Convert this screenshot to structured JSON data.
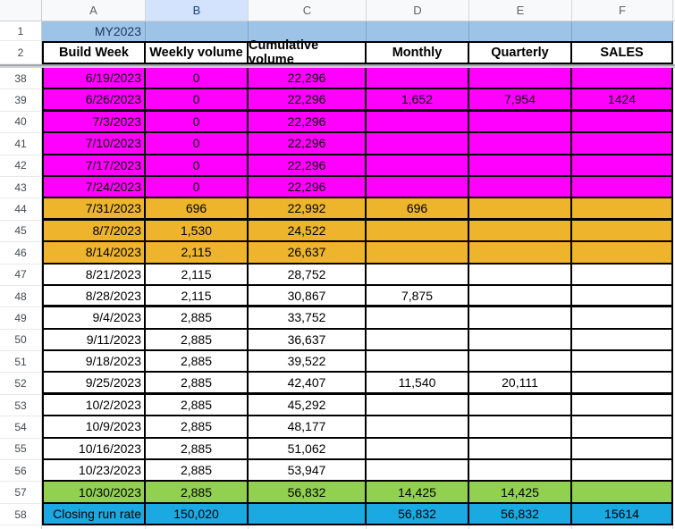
{
  "sheet": {
    "column_headers": [
      "A",
      "B",
      "C",
      "D",
      "E",
      "F"
    ],
    "selected_column": "B",
    "banner": {
      "row_number": "1",
      "text": "MY2023"
    },
    "header_row": {
      "row_number": "2",
      "cells": [
        "Build Week",
        "Weekly volume",
        "Cumulative volume",
        "Monthly",
        "Quarterly",
        "SALES"
      ]
    },
    "rows": [
      {
        "n": "38",
        "color": "magenta",
        "thick": false,
        "cells": [
          "6/19/2023",
          "0",
          "22,296",
          "",
          "",
          ""
        ]
      },
      {
        "n": "39",
        "color": "magenta",
        "thick": true,
        "cells": [
          "6/26/2023",
          "0",
          "22,296",
          "1,652",
          "7,954",
          "1424"
        ]
      },
      {
        "n": "40",
        "color": "magenta",
        "thick": false,
        "cells": [
          "7/3/2023",
          "0",
          "22,296",
          "",
          "",
          ""
        ]
      },
      {
        "n": "41",
        "color": "magenta",
        "thick": false,
        "cells": [
          "7/10/2023",
          "0",
          "22,296",
          "",
          "",
          ""
        ]
      },
      {
        "n": "42",
        "color": "magenta",
        "thick": false,
        "cells": [
          "7/17/2023",
          "0",
          "22,296",
          "",
          "",
          ""
        ]
      },
      {
        "n": "43",
        "color": "magenta",
        "thick": false,
        "cells": [
          "7/24/2023",
          "0",
          "22,296",
          "",
          "",
          ""
        ]
      },
      {
        "n": "44",
        "color": "orange",
        "thick": true,
        "cells": [
          "7/31/2023",
          "696",
          "22,992",
          "696",
          "",
          ""
        ]
      },
      {
        "n": "45",
        "color": "orange",
        "thick": false,
        "cells": [
          "8/7/2023",
          "1,530",
          "24,522",
          "",
          "",
          ""
        ]
      },
      {
        "n": "46",
        "color": "orange",
        "thick": false,
        "cells": [
          "8/14/2023",
          "2,115",
          "26,637",
          "",
          "",
          ""
        ]
      },
      {
        "n": "47",
        "color": "white",
        "thick": false,
        "cells": [
          "8/21/2023",
          "2,115",
          "28,752",
          "",
          "",
          ""
        ]
      },
      {
        "n": "48",
        "color": "white",
        "thick": true,
        "cells": [
          "8/28/2023",
          "2,115",
          "30,867",
          "7,875",
          "",
          ""
        ]
      },
      {
        "n": "49",
        "color": "white",
        "thick": false,
        "cells": [
          "9/4/2023",
          "2,885",
          "33,752",
          "",
          "",
          ""
        ]
      },
      {
        "n": "50",
        "color": "white",
        "thick": false,
        "cells": [
          "9/11/2023",
          "2,885",
          "36,637",
          "",
          "",
          ""
        ]
      },
      {
        "n": "51",
        "color": "white",
        "thick": false,
        "cells": [
          "9/18/2023",
          "2,885",
          "39,522",
          "",
          "",
          ""
        ]
      },
      {
        "n": "52",
        "color": "white",
        "thick": true,
        "cells": [
          "9/25/2023",
          "2,885",
          "42,407",
          "11,540",
          "20,111",
          ""
        ]
      },
      {
        "n": "53",
        "color": "white",
        "thick": false,
        "cells": [
          "10/2/2023",
          "2,885",
          "45,292",
          "",
          "",
          ""
        ]
      },
      {
        "n": "54",
        "color": "white",
        "thick": false,
        "cells": [
          "10/9/2023",
          "2,885",
          "48,177",
          "",
          "",
          ""
        ]
      },
      {
        "n": "55",
        "color": "white",
        "thick": false,
        "cells": [
          "10/16/2023",
          "2,885",
          "51,062",
          "",
          "",
          ""
        ]
      },
      {
        "n": "56",
        "color": "white",
        "thick": false,
        "cells": [
          "10/23/2023",
          "2,885",
          "53,947",
          "",
          "",
          ""
        ]
      },
      {
        "n": "57",
        "color": "green",
        "thick": false,
        "cells": [
          "10/30/2023",
          "2,885",
          "56,832",
          "14,425",
          "14,425",
          ""
        ]
      },
      {
        "n": "58",
        "color": "cyan",
        "thick": false,
        "cells": [
          "Closing run rate",
          "150,020",
          "",
          "56,832",
          "56,832",
          "15614"
        ]
      }
    ],
    "colors": {
      "magenta": "#FF00FF",
      "orange": "#EDB42C",
      "green": "#92D050",
      "cyan": "#1BA9E2",
      "white": "#FFFFFF",
      "banner_blue": "#9DC3E6",
      "selected_header_bg": "#D3E3FD"
    }
  }
}
